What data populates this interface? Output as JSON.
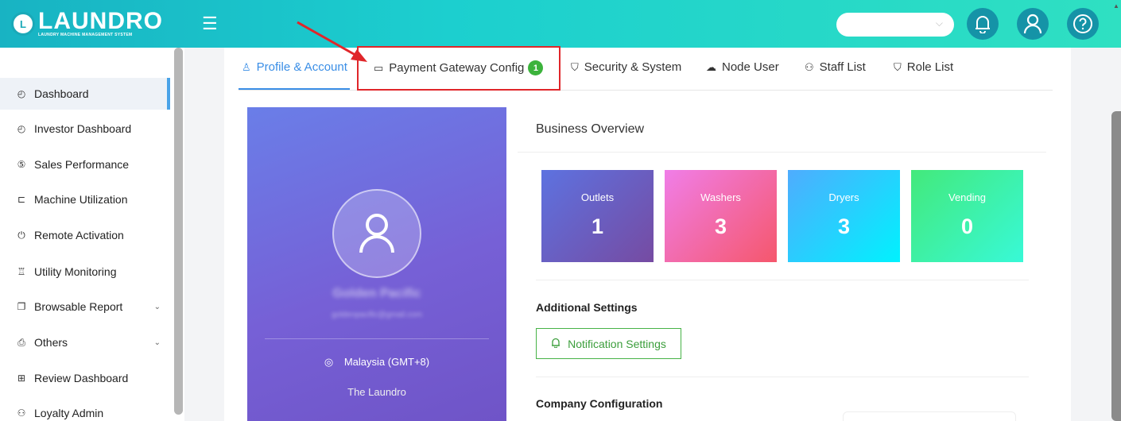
{
  "header": {
    "logo_text": "LAUNDRO",
    "logo_letter": "L",
    "logo_subtitle": "LAUNDRY MACHINE MANAGEMENT SYSTEM",
    "menu_icon": "hamburger-icon",
    "select_value": "",
    "icons": [
      "bell-icon",
      "user-icon",
      "help-icon"
    ]
  },
  "sidebar": {
    "items": [
      {
        "label": "Dashboard",
        "icon": "gauge-icon",
        "glyph": "◴",
        "active": true
      },
      {
        "label": "Investor Dashboard",
        "icon": "gauge-icon",
        "glyph": "◴"
      },
      {
        "label": "Sales Performance",
        "icon": "dollar-icon",
        "glyph": "⑤"
      },
      {
        "label": "Machine Utilization",
        "icon": "machine-icon",
        "glyph": "⊏"
      },
      {
        "label": "Remote Activation",
        "icon": "power-icon",
        "glyph": "⏻"
      },
      {
        "label": "Utility Monitoring",
        "icon": "utility-icon",
        "glyph": "♖"
      },
      {
        "label": "Browsable Report",
        "icon": "report-icon",
        "glyph": "❐",
        "expandable": true
      },
      {
        "label": "Others",
        "icon": "folder-icon",
        "glyph": "⎙",
        "expandable": true
      },
      {
        "label": "Review Dashboard",
        "icon": "review-icon",
        "glyph": "⊞"
      },
      {
        "label": "Loyalty Admin",
        "icon": "loyalty-icon",
        "glyph": "⚇"
      }
    ]
  },
  "tabs": [
    {
      "label": "Profile & Account",
      "icon": "user-icon",
      "glyph": "♙",
      "active": true
    },
    {
      "label": "Payment Gateway Config",
      "icon": "card-icon",
      "glyph": "▭",
      "badge": "1"
    },
    {
      "label": "Security & System",
      "icon": "shield-icon",
      "glyph": "⛉"
    },
    {
      "label": "Node User",
      "icon": "cloud-icon",
      "glyph": "☁"
    },
    {
      "label": "Staff List",
      "icon": "staff-icon",
      "glyph": "⚇"
    },
    {
      "label": "Role List",
      "icon": "shield-check-icon",
      "glyph": "⛉"
    }
  ],
  "profile": {
    "name": "Golden Pacific",
    "email": "goldenpacific@gmail.com",
    "location": "Malaysia (GMT+8)",
    "company": "The Laundro"
  },
  "overview": {
    "title": "Business Overview",
    "cards": [
      {
        "label": "Outlets",
        "value": "1",
        "color_from": "#5d72e0",
        "color_to": "#764ba2"
      },
      {
        "label": "Washers",
        "value": "3",
        "color_from": "#f07ee8",
        "color_to": "#f5576c"
      },
      {
        "label": "Dryers",
        "value": "3",
        "color_from": "#4facfe",
        "color_to": "#00f2fe"
      },
      {
        "label": "Vending",
        "value": "0",
        "color_from": "#43e97b",
        "color_to": "#38f9d7"
      }
    ]
  },
  "additional": {
    "title": "Additional Settings",
    "notification_button": "Notification Settings"
  },
  "company": {
    "title": "Company Configuration"
  },
  "colors": {
    "accent": "#3a8ee6",
    "header_from": "#18b3c3",
    "header_to": "#2fe0c2",
    "highlight": "#e0262a",
    "badge": "#3cb33c"
  }
}
